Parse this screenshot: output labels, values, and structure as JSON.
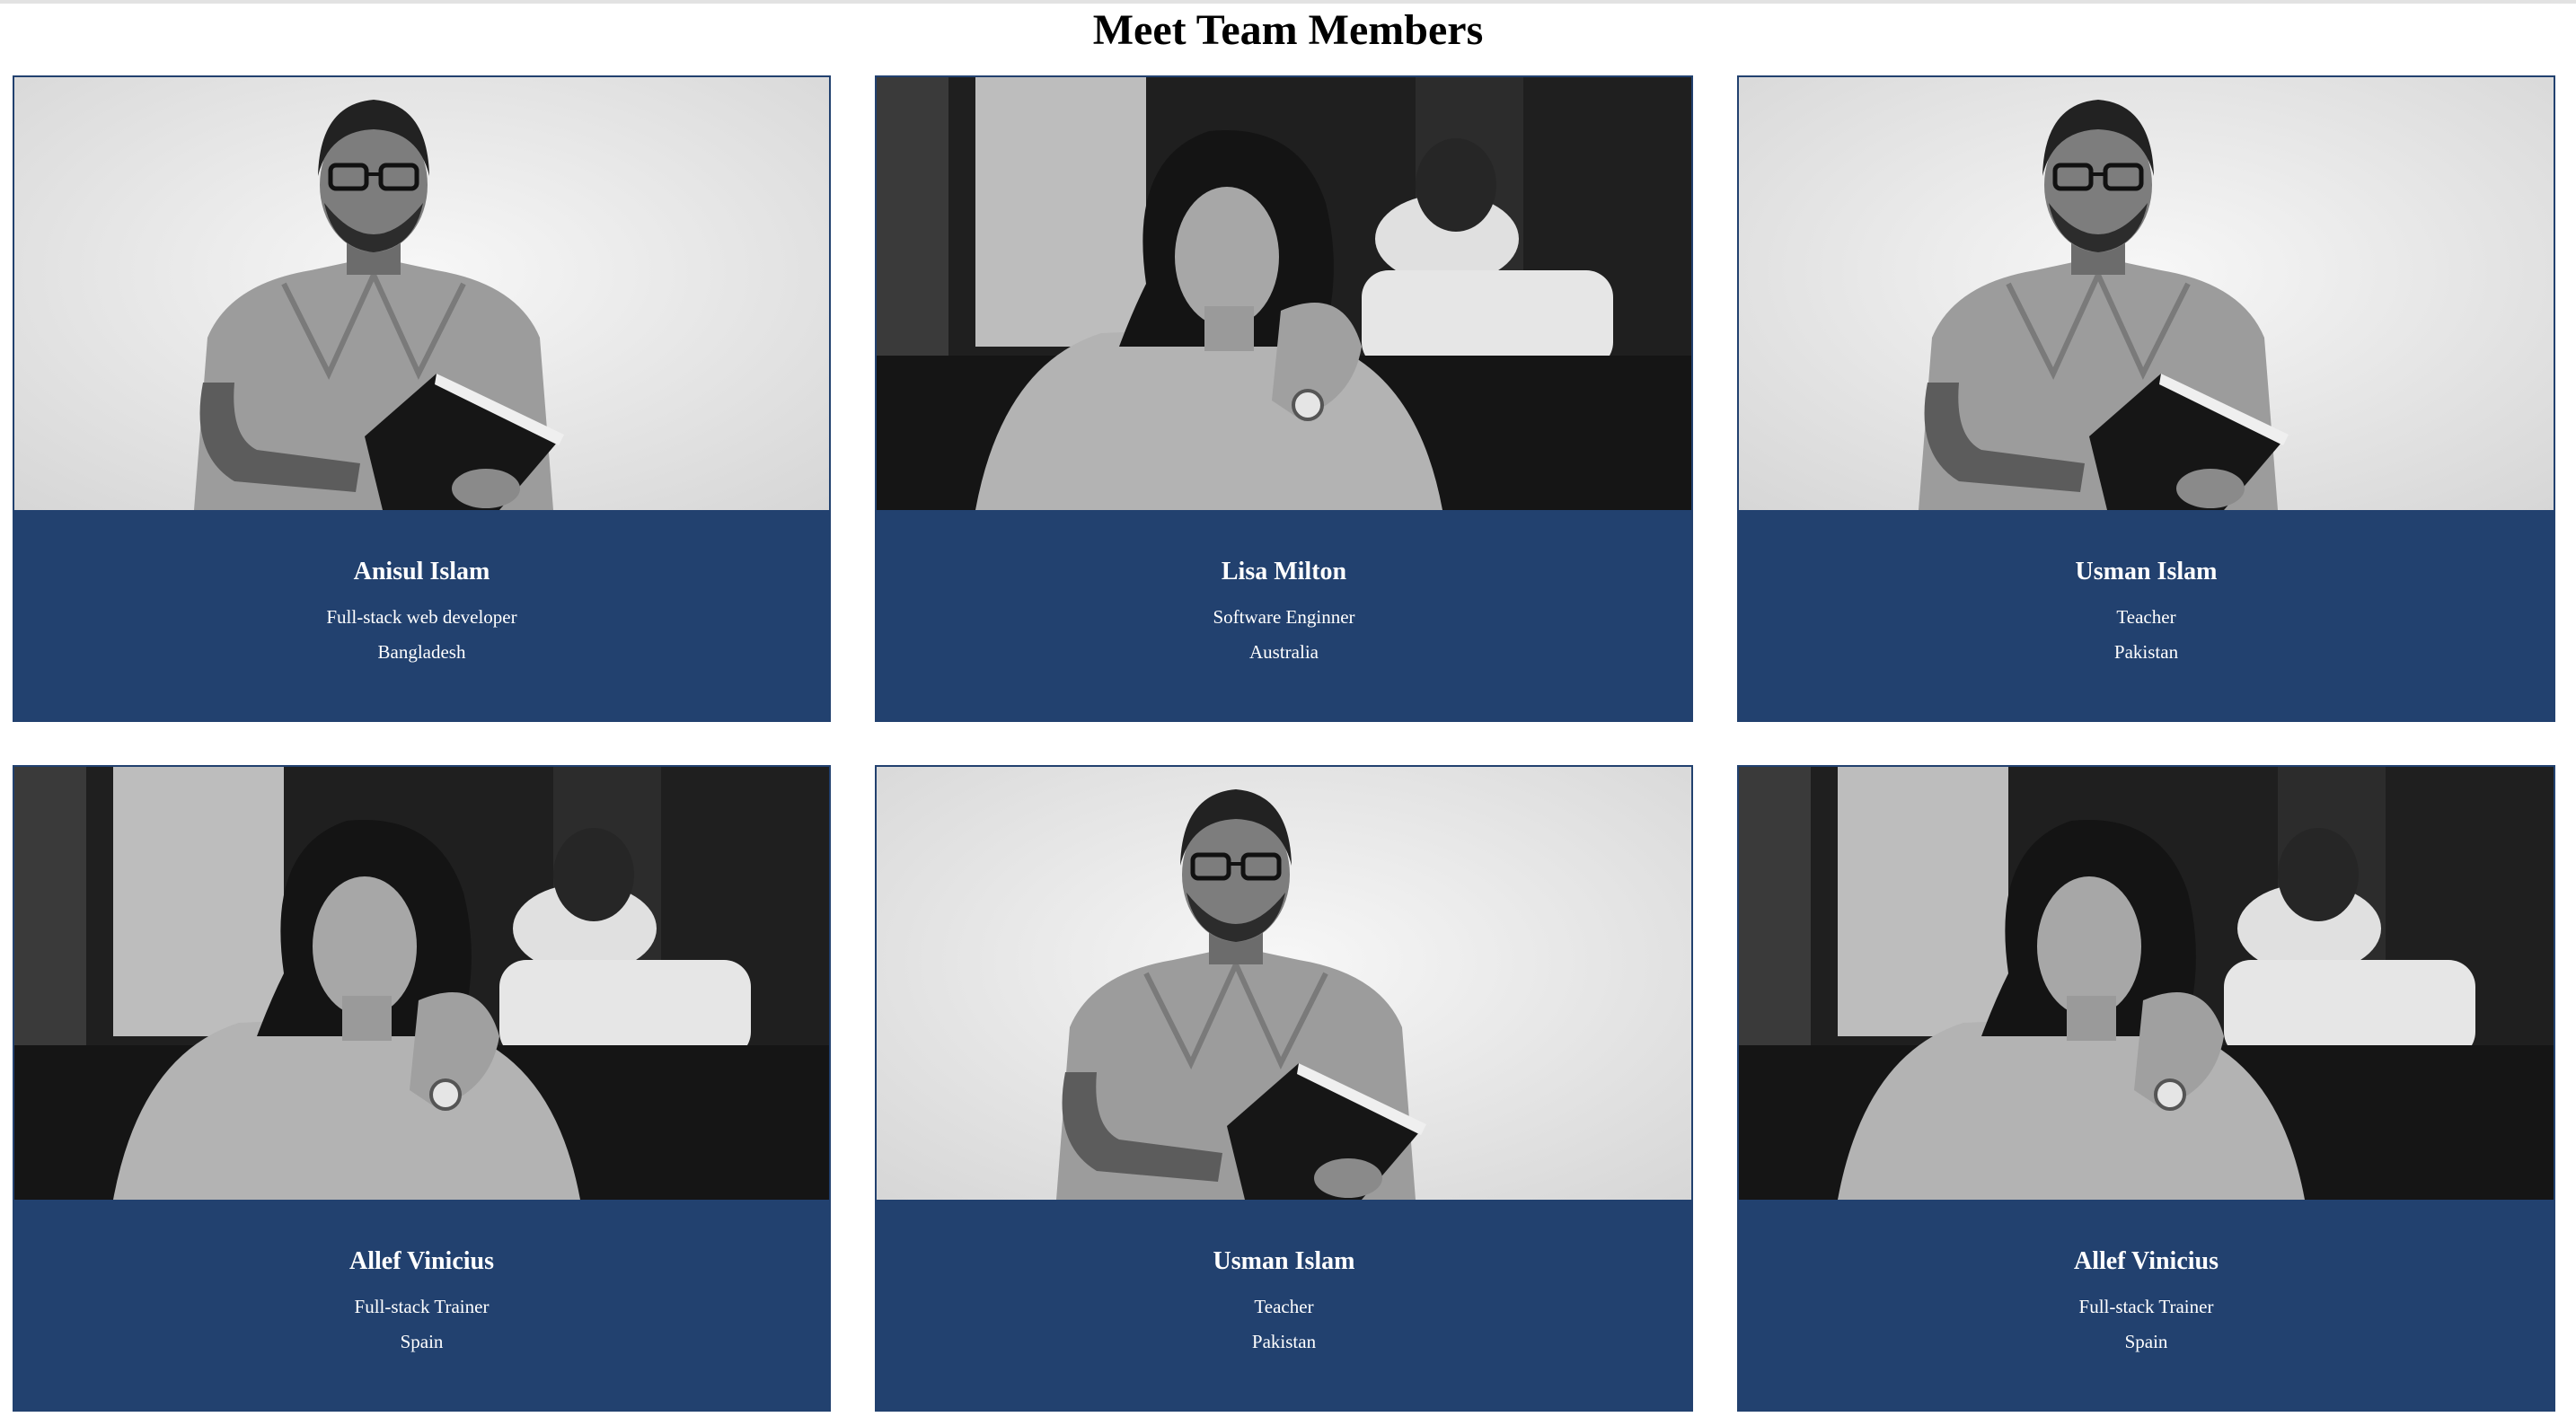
{
  "page": {
    "title": "Meet Team Members"
  },
  "colors": {
    "card_bg": "#22416f",
    "text": "#ffffff",
    "title": "#000000"
  },
  "members": [
    {
      "name": "Anisul Islam",
      "role": "Full-stack web developer",
      "country": "Bangladesh",
      "photo": "man-with-glasses-holding-book"
    },
    {
      "name": "Lisa Milton",
      "role": "Software Enginner",
      "country": "Australia",
      "photo": "woman-short-hair-seated"
    },
    {
      "name": "Usman Islam",
      "role": "Teacher",
      "country": "Pakistan",
      "photo": "man-with-glasses-holding-book"
    },
    {
      "name": "Allef Vinicius",
      "role": "Full-stack Trainer",
      "country": "Spain",
      "photo": "woman-short-hair-seated"
    },
    {
      "name": "Usman Islam",
      "role": "Teacher",
      "country": "Pakistan",
      "photo": "man-with-glasses-holding-book"
    },
    {
      "name": "Allef Vinicius",
      "role": "Full-stack Trainer",
      "country": "Spain",
      "photo": "woman-short-hair-seated"
    }
  ]
}
